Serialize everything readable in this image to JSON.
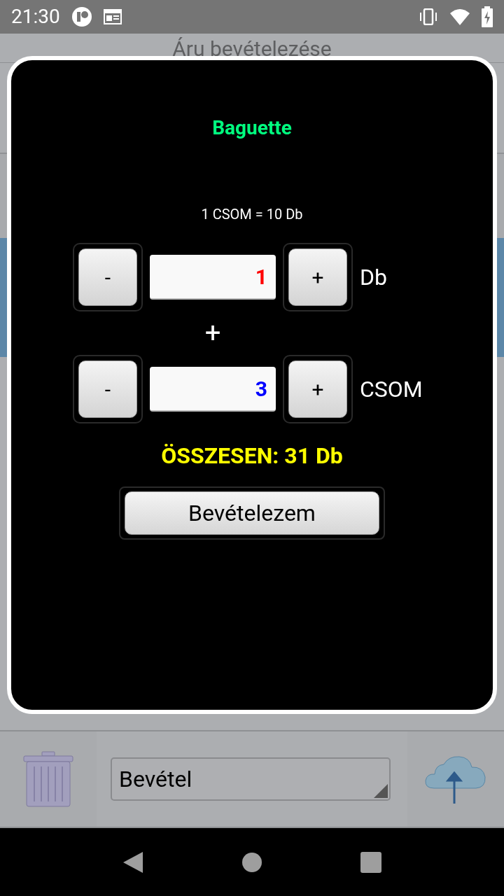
{
  "status_bar": {
    "time": "21:30"
  },
  "screen": {
    "title": "Áru bevételezése"
  },
  "dialog": {
    "product": "Baguette",
    "conversion": "1 CSOM = 10 Db",
    "quantities": [
      {
        "decrement": "-",
        "value": "1",
        "increment": "+",
        "unit": "Db",
        "color": "#ff0000"
      },
      {
        "decrement": "-",
        "value": "3",
        "increment": "+",
        "unit": "CSOM",
        "color": "#0000ff"
      }
    ],
    "separator": "+",
    "total": "ÖSSZESEN: 31 Db",
    "confirm_button": "Bevételezem"
  },
  "bottom_bar": {
    "type_select": "Bevétel"
  }
}
